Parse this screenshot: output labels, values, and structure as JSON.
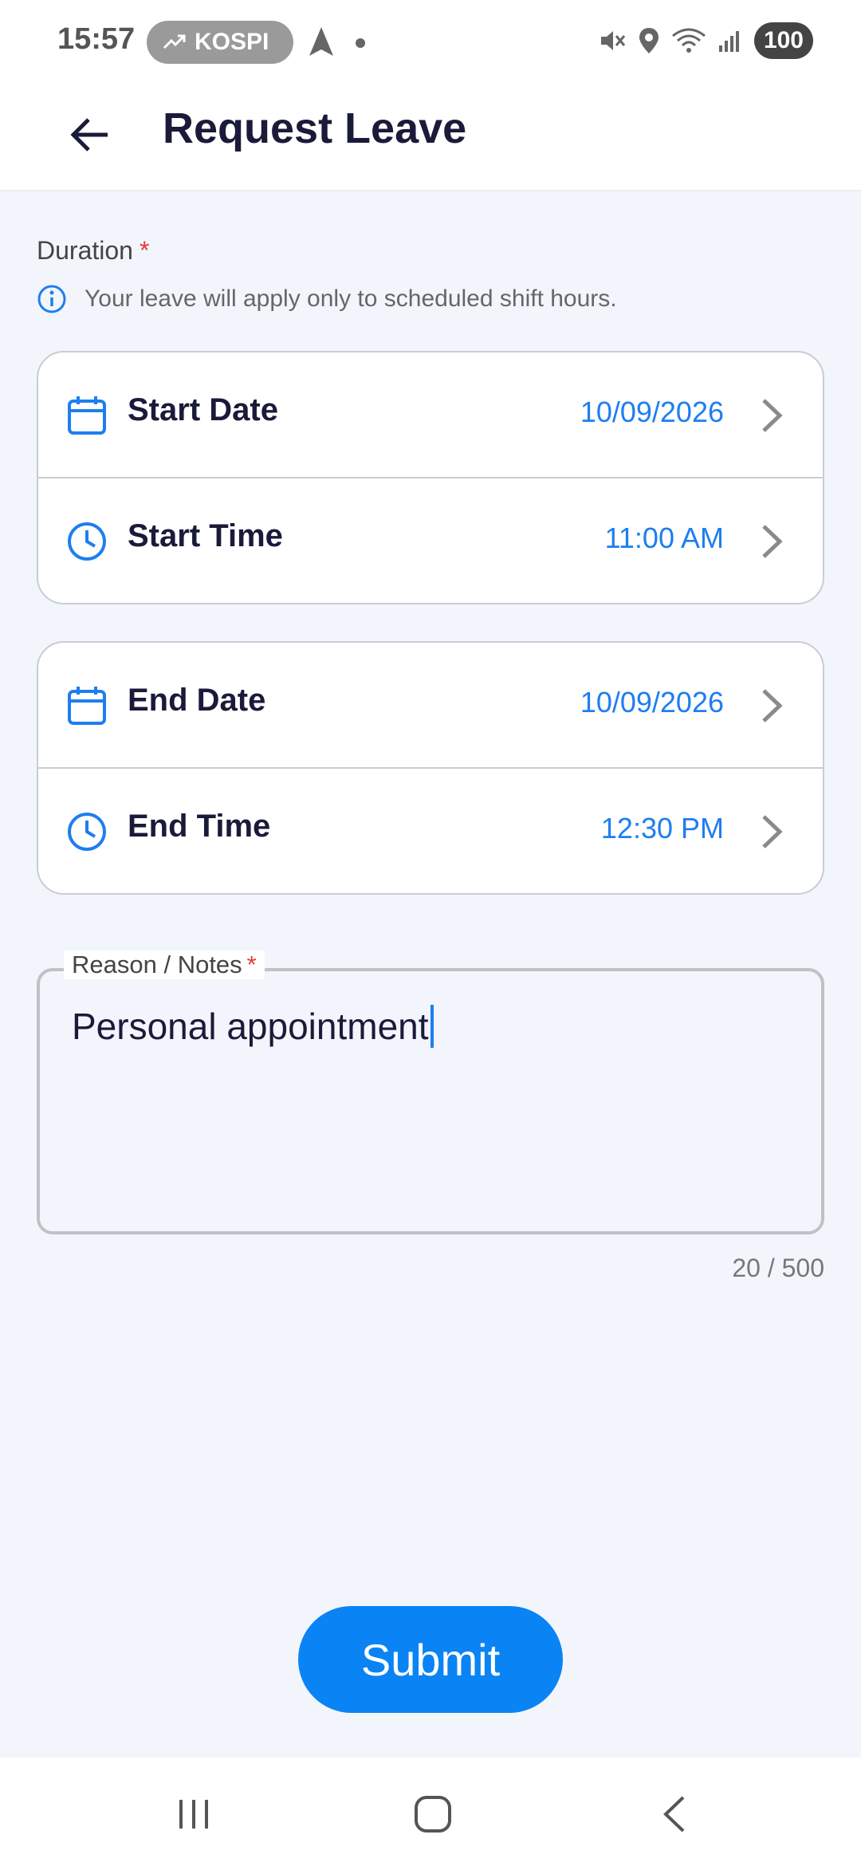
{
  "status_bar": {
    "time": "15:57",
    "ticker": "KOSPI",
    "battery": "100"
  },
  "header": {
    "title": "Request Leave",
    "back_icon": "arrow-left-icon"
  },
  "duration": {
    "label": "Duration",
    "required_mark": "*",
    "info_text": "Your leave will apply only to scheduled shift hours."
  },
  "start": {
    "date_label": "Start Date",
    "date_value": "10/09/2026",
    "time_label": "Start Time",
    "time_value": "11:00 AM"
  },
  "end": {
    "date_label": "End Date",
    "date_value": "10/09/2026",
    "time_label": "End Time",
    "time_value": "12:30 PM"
  },
  "notes": {
    "label": "Reason / Notes",
    "required_mark": "*",
    "value": "Personal appointment",
    "counter": "20 / 500"
  },
  "submit_label": "Submit",
  "colors": {
    "accent": "#0a84f5",
    "value_blue": "#1e7ef0",
    "required_red": "#e53935",
    "background": "#f3f5fc"
  }
}
